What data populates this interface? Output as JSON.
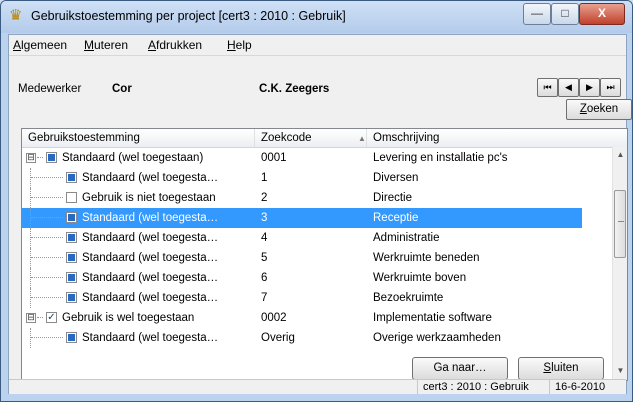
{
  "window": {
    "title": "Gebruikstoestemming per project  [cert3 : 2010 : Gebruik]",
    "controls": {
      "minimize": "—",
      "maximize": "□",
      "close": "X"
    }
  },
  "menu": [
    {
      "label": "Algemeen",
      "mnemonic": "A",
      "rest": "lgemeen"
    },
    {
      "label": "Muteren",
      "mnemonic": "M",
      "rest": "uteren"
    },
    {
      "label": "Afdrukken",
      "mnemonic": "A",
      "rest": "fdrukken"
    },
    {
      "label": "Help",
      "mnemonic": "H",
      "rest": "elp"
    }
  ],
  "employee": {
    "label": "Medewerker",
    "code": "Cor",
    "name": "C.K. Zeegers"
  },
  "nav": {
    "first": "⏮",
    "prev": "◀",
    "next": "▶",
    "last": "⏭",
    "search_mnemonic": "Z",
    "search_rest": "oeken"
  },
  "grid": {
    "columns": [
      "Gebruikstoestemming",
      "Zoekcode",
      "Omschrijving"
    ],
    "sort_icon": "▲",
    "rows": [
      {
        "level": 0,
        "expander": "⊟",
        "check": "filled",
        "label": "Standaard (wel toegestaan)",
        "code": "0001",
        "desc": "Levering en installatie pc's"
      },
      {
        "level": 1,
        "check": "filled",
        "label": "Standaard (wel toegesta…",
        "code": "1",
        "desc": "Diversen"
      },
      {
        "level": 1,
        "check": "empty",
        "label": "Gebruik is niet toegestaan",
        "code": "2",
        "desc": "Directie"
      },
      {
        "level": 1,
        "check": "filled",
        "label": "Standaard (wel toegesta…",
        "code": "3",
        "desc": "Receptie",
        "selected": true
      },
      {
        "level": 1,
        "check": "filled",
        "label": "Standaard (wel toegesta…",
        "code": "4",
        "desc": "Administratie"
      },
      {
        "level": 1,
        "check": "filled",
        "label": "Standaard (wel toegesta…",
        "code": "5",
        "desc": "Werkruimte beneden"
      },
      {
        "level": 1,
        "check": "filled",
        "label": "Standaard (wel toegesta…",
        "code": "6",
        "desc": "Werkruimte boven"
      },
      {
        "level": 1,
        "check": "filled",
        "label": "Standaard (wel toegesta…",
        "code": "7",
        "desc": "Bezoekruimte"
      },
      {
        "level": 0,
        "expander": "⊟",
        "check": "checked",
        "label": "Gebruik is wel toegestaan",
        "code": "0002",
        "desc": "Implementatie software"
      },
      {
        "level": 1,
        "check": "filled",
        "label": "Standaard (wel toegesta…",
        "code": "Overig",
        "desc": "Overige werkzaamheden"
      }
    ]
  },
  "buttons": {
    "goto": "Ga naar…",
    "close_mnemonic": "S",
    "close_rest": "luiten"
  },
  "status": {
    "context": "cert3 : 2010 : Gebruik",
    "date": "16-6-2010"
  },
  "colors": {
    "selection": "#3399ff",
    "checkbox_fill": "#2a69c2",
    "title_bg": "#bcd3ef"
  }
}
